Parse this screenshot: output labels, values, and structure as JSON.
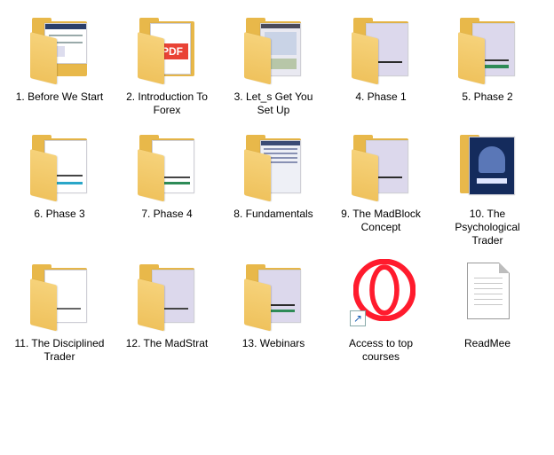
{
  "window": {
    "title": ""
  },
  "items": [
    {
      "label": "1. Before We Start",
      "type": "folder",
      "preview": "chart"
    },
    {
      "label": "2. Introduction To Forex",
      "type": "folder",
      "preview": "pdf"
    },
    {
      "label": "3. Let_s Get You Set Up",
      "type": "folder",
      "preview": "screens"
    },
    {
      "label": "4. Phase 1",
      "type": "folder",
      "preview": "chart"
    },
    {
      "label": "5. Phase 2",
      "type": "folder",
      "preview": "chart"
    },
    {
      "label": "6. Phase 3",
      "type": "folder",
      "preview": "chart"
    },
    {
      "label": "7. Phase 4",
      "type": "folder",
      "preview": "chart"
    },
    {
      "label": "8. Fundamentals",
      "type": "folder",
      "preview": "screens"
    },
    {
      "label": "9. The MadBlock Concept",
      "type": "folder",
      "preview": "chart"
    },
    {
      "label": "10. The Psychological Trader",
      "type": "folder",
      "preview": "art"
    },
    {
      "label": "11. The Disciplined Trader",
      "type": "folder",
      "preview": "chart"
    },
    {
      "label": "12. The MadStrat",
      "type": "folder",
      "preview": "chart"
    },
    {
      "label": "13. Webinars",
      "type": "folder",
      "preview": "chart"
    },
    {
      "label": "Access to top courses",
      "type": "shortcut",
      "icon": "opera-icon"
    },
    {
      "label": "ReadMee",
      "type": "text-file",
      "icon": "document-icon"
    }
  ],
  "colors": {
    "folder": "#efc25d",
    "opera": "#ff1b2d",
    "pdf": "#e94335"
  }
}
